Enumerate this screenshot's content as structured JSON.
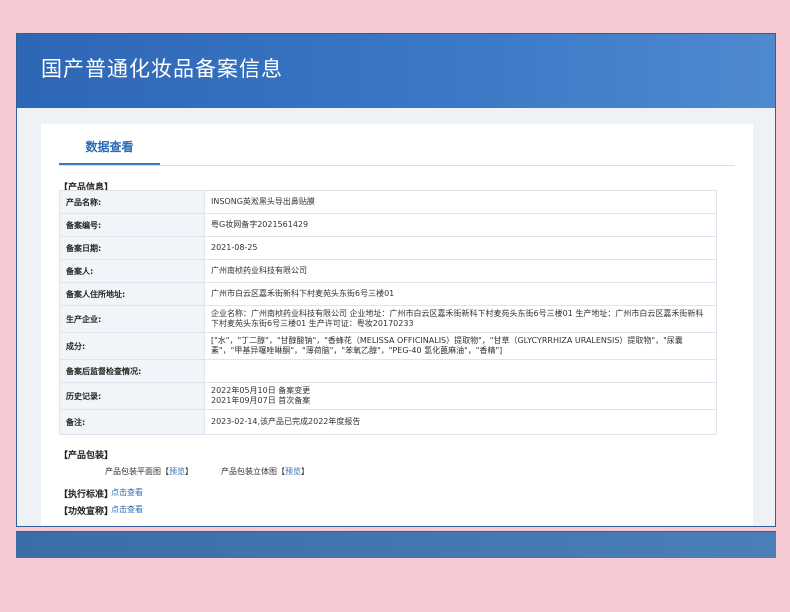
{
  "header": {
    "title": "国产普通化妆品备案信息"
  },
  "tabs": [
    {
      "label": "数据查看"
    }
  ],
  "product_info": {
    "section_label": "【产品信息】",
    "rows": [
      {
        "label": "产品名称:",
        "value": "INSONG英淞黑头导出鼻贴膜"
      },
      {
        "label": "备案编号:",
        "value": "粤G妆网备字2021561429"
      },
      {
        "label": "备案日期:",
        "value": "2021-08-25"
      },
      {
        "label": "备案人:",
        "value": "广州南桢药业科技有限公司"
      },
      {
        "label": "备案人住所地址:",
        "value": "广州市白云区嘉禾街新科下村麦苑头东街6号三楼01"
      },
      {
        "label": "生产企业:",
        "value": "企业名称：广州南桢药业科技有限公司 企业地址：广州市白云区嘉禾街新科下村麦苑头东街6号三楼01 生产地址：广州市白云区嘉禾街新科下村麦苑头东街6号三楼01 生产许可证：粤妆20170233"
      },
      {
        "label": "成分:",
        "value": "[\"水\"，\"丁二醇\"，\"甘醇酸钠\"，\"香蜂花（MELISSA OFFICINALIS）提取物\"，\"甘草（GLYCYRRHIZA URALENSIS）提取物\"，\"尿囊素\"，\"甲基异噻唑啉酮\"，\"薄荷脑\"，\"苯氧乙醇\"，\"PEG-40 氢化蓖麻油\"，\"香精\"]"
      },
      {
        "label": "备案后监督检查情况:",
        "value": ""
      },
      {
        "label": "历史记录:",
        "value_line1": "2022年05月10日 备案变更",
        "value_line2": "2021年09月07日 首次备案"
      },
      {
        "label": "备注:",
        "value": "2023-02-14,该产品已完成2022年度报告"
      }
    ]
  },
  "packaging": {
    "section_label": "【产品包装】",
    "flat_label": "产品包装平面图【",
    "flat_link": "预览",
    "flat_close": "】",
    "solid_label": "产品包装立体图【",
    "solid_link": "预览",
    "solid_close": "】"
  },
  "standard": {
    "section_label": "【执行标准】",
    "link": "点击查看"
  },
  "efficacy": {
    "section_label": "【功效宣称】",
    "link": "点击查看"
  }
}
